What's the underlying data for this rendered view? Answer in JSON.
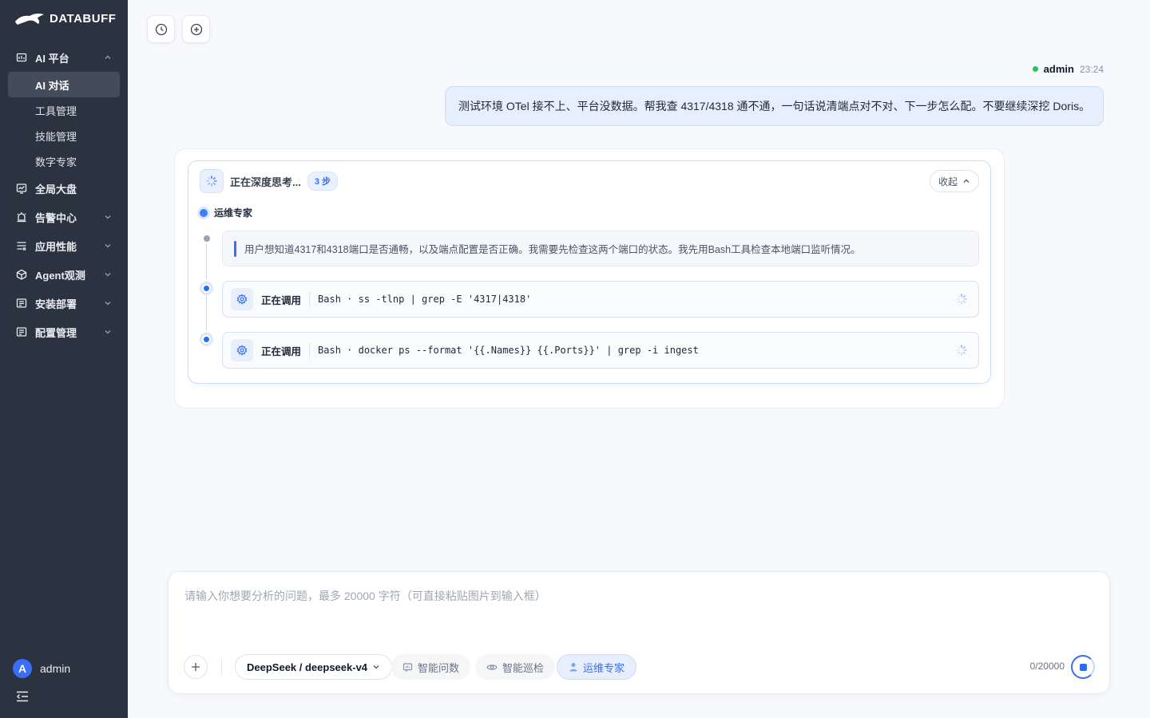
{
  "brand": {
    "name": "DATABUFF"
  },
  "sidebar": {
    "groups": [
      {
        "label": "AI 平台",
        "icon": "ai-platform-icon",
        "expanded": true,
        "items": [
          {
            "label": "AI 对话",
            "active": true
          },
          {
            "label": "工具管理"
          },
          {
            "label": "技能管理"
          },
          {
            "label": "数字专家"
          }
        ]
      },
      {
        "label": "全局大盘",
        "icon": "dashboard-icon"
      },
      {
        "label": "告警中心",
        "icon": "alarm-icon"
      },
      {
        "label": "应用性能",
        "icon": "apm-icon"
      },
      {
        "label": "Agent观测",
        "icon": "cube-icon"
      },
      {
        "label": "安装部署",
        "icon": "deploy-icon"
      },
      {
        "label": "配置管理",
        "icon": "config-icon"
      }
    ],
    "user": {
      "avatar_letter": "A",
      "name": "admin"
    }
  },
  "conversation": {
    "user_message": {
      "author": "admin",
      "time": "23:24",
      "text": "测试环境 OTel 接不上、平台没数据。帮我查 4317/4318 通不通，一句话说清端点对不对、下一步怎么配。不要继续深挖 Doris。"
    },
    "thinking": {
      "title": "正在深度思考...",
      "steps_badge": "3 步",
      "collapse_label": "收起",
      "agent": "运维专家",
      "thought": "用户想知道4317和4318端口是否通畅，以及端点配置是否正确。我需要先检查这两个端口的状态。我先用Bash工具检查本地端口监听情况。",
      "tool_calls": [
        {
          "status": "正在调用",
          "command": "Bash · ss -tlnp | grep -E '4317|4318'"
        },
        {
          "status": "正在调用",
          "command": "Bash · docker ps --format '{{.Names}} {{.Ports}}' | grep -i ingest"
        }
      ]
    }
  },
  "composer": {
    "placeholder": "请输入你想要分析的问题，最多 20000 字符（可直接粘贴图片到输入框）",
    "value": "",
    "model": "DeepSeek / deepseek-v4",
    "modes": [
      {
        "label": "智能问数",
        "icon": "chat-data-icon"
      },
      {
        "label": "智能巡检",
        "icon": "eye-icon"
      },
      {
        "label": "运维专家",
        "icon": "person-icon",
        "active": true
      }
    ],
    "counter": "0/20000"
  },
  "colors": {
    "accent": "#3b6df6",
    "sidebar_bg": "#2b3240",
    "online": "#22c55e"
  }
}
